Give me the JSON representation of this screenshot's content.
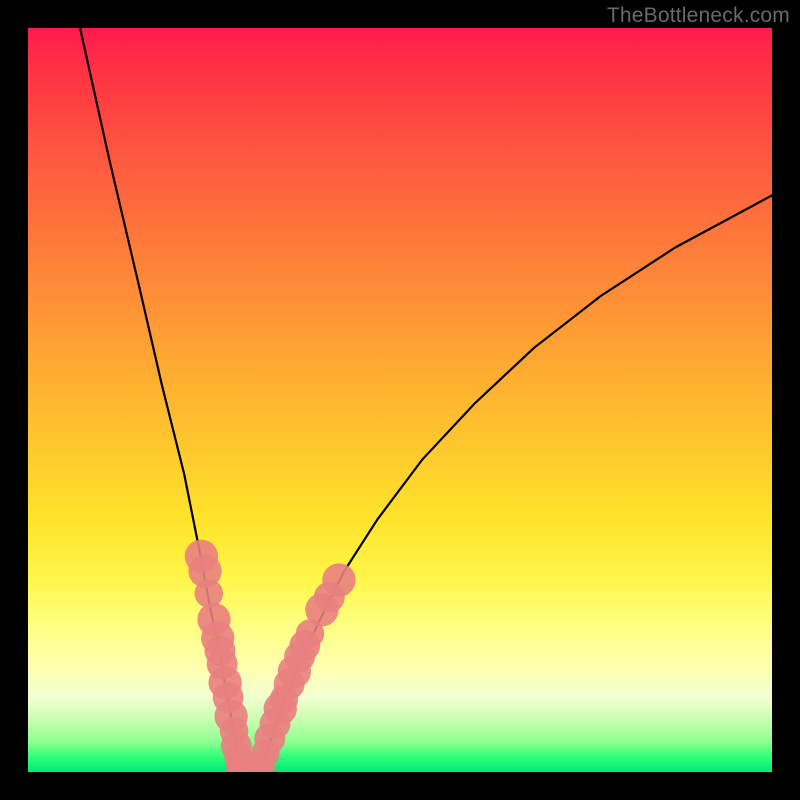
{
  "watermark": "TheBottleneck.com",
  "colors": {
    "curve": "#000000",
    "dots": "#e98080",
    "background_top": "#ff1a4d",
    "background_bottom": "#00e879",
    "frame": "#000000"
  },
  "chart_data": {
    "type": "line",
    "title": "",
    "xlabel": "",
    "ylabel": "",
    "xlim": [
      0,
      100
    ],
    "ylim": [
      0,
      100
    ],
    "series": [
      {
        "name": "left-curve",
        "x": [
          7,
          11,
          15,
          18,
          21,
          23,
          24.5,
          25.8,
          26.6,
          27.2,
          27.6,
          28.0,
          28.3,
          29.0
        ],
        "values": [
          100,
          82,
          65,
          52,
          40,
          30,
          22,
          16,
          11,
          8,
          5.5,
          3.5,
          2.0,
          0.0
        ]
      },
      {
        "name": "right-curve",
        "x": [
          31.0,
          32.0,
          33.0,
          34.5,
          36.5,
          39.0,
          42.5,
          47.0,
          53.0,
          60.0,
          68.0,
          77.0,
          87.0,
          100.0
        ],
        "values": [
          0.0,
          2.5,
          5.5,
          9.5,
          14.5,
          20.0,
          27.0,
          34.0,
          42.0,
          49.5,
          57.0,
          64.0,
          70.5,
          77.5
        ]
      }
    ],
    "floor_segment": {
      "name": "valley-floor",
      "x": [
        29.0,
        31.0
      ],
      "values": [
        0,
        0
      ]
    },
    "clusters": [
      {
        "name": "left-band-dots",
        "points": [
          {
            "x": 23.3,
            "y": 29.0,
            "r": 1.4
          },
          {
            "x": 23.8,
            "y": 27.0,
            "r": 1.4
          },
          {
            "x": 24.3,
            "y": 24.0,
            "r": 1.2
          },
          {
            "x": 25.0,
            "y": 20.5,
            "r": 1.4
          },
          {
            "x": 25.5,
            "y": 18.0,
            "r": 1.4
          },
          {
            "x": 25.8,
            "y": 16.3,
            "r": 1.3
          },
          {
            "x": 26.1,
            "y": 14.5,
            "r": 1.3
          },
          {
            "x": 26.5,
            "y": 12.0,
            "r": 1.4
          },
          {
            "x": 26.9,
            "y": 10.0,
            "r": 1.3
          },
          {
            "x": 27.3,
            "y": 7.5,
            "r": 1.4
          },
          {
            "x": 27.7,
            "y": 5.5,
            "r": 1.2
          },
          {
            "x": 28.0,
            "y": 3.5,
            "r": 1.3
          },
          {
            "x": 28.3,
            "y": 2.0,
            "r": 1.2
          }
        ]
      },
      {
        "name": "right-band-dots",
        "points": [
          {
            "x": 31.9,
            "y": 2.5,
            "r": 1.2
          },
          {
            "x": 32.5,
            "y": 4.5,
            "r": 1.3
          },
          {
            "x": 33.2,
            "y": 6.5,
            "r": 1.3
          },
          {
            "x": 33.9,
            "y": 8.5,
            "r": 1.4
          },
          {
            "x": 34.4,
            "y": 9.8,
            "r": 1.2
          },
          {
            "x": 35.1,
            "y": 11.8,
            "r": 1.3
          },
          {
            "x": 35.8,
            "y": 13.5,
            "r": 1.4
          },
          {
            "x": 36.5,
            "y": 15.5,
            "r": 1.3
          },
          {
            "x": 37.2,
            "y": 17.0,
            "r": 1.3
          },
          {
            "x": 37.9,
            "y": 18.6,
            "r": 1.2
          },
          {
            "x": 39.5,
            "y": 21.8,
            "r": 1.4
          },
          {
            "x": 40.5,
            "y": 23.5,
            "r": 1.3
          },
          {
            "x": 41.8,
            "y": 25.8,
            "r": 1.4
          }
        ]
      },
      {
        "name": "valley-floor-dots",
        "points": [
          {
            "x": 28.7,
            "y": 0.6,
            "r": 1.3
          },
          {
            "x": 29.3,
            "y": 0.5,
            "r": 1.3
          },
          {
            "x": 29.9,
            "y": 0.5,
            "r": 1.3
          },
          {
            "x": 30.5,
            "y": 0.5,
            "r": 1.3
          },
          {
            "x": 31.1,
            "y": 0.6,
            "r": 1.3
          }
        ]
      }
    ]
  }
}
